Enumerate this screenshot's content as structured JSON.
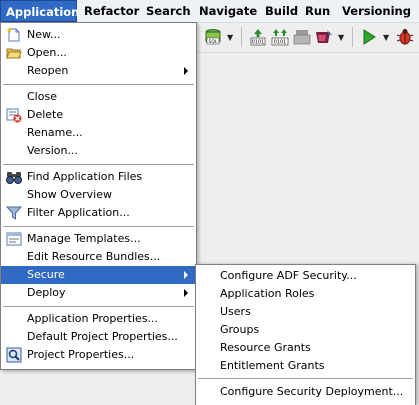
{
  "menubar": {
    "items": [
      "Application",
      "Refactor",
      "Search",
      "Navigate",
      "Build",
      "Run",
      "Versioning"
    ]
  },
  "toolbar": {
    "icons": [
      "sql-icon",
      "compile-icon",
      "make-icon",
      "rebuild-icon",
      "deploy-icon",
      "run-icon",
      "debug-icon"
    ]
  },
  "application_menu": {
    "new": "New...",
    "open": "Open...",
    "reopen": "Reopen",
    "close": "Close",
    "delete": "Delete",
    "rename": "Rename...",
    "version": "Version...",
    "find_files": "Find Application Files",
    "show_overview": "Show Overview",
    "filter": "Filter Application...",
    "manage_templates": "Manage Templates...",
    "edit_resource_bundles": "Edit Resource Bundles...",
    "secure": "Secure",
    "deploy": "Deploy",
    "app_properties": "Application Properties...",
    "default_project_properties": "Default Project Properties...",
    "project_properties": "Project Properties..."
  },
  "secure_menu": {
    "configure_adf": "Configure ADF Security...",
    "app_roles": "Application Roles",
    "users": "Users",
    "groups": "Groups",
    "resource_grants": "Resource Grants",
    "entitlement_grants": "Entitlement Grants",
    "configure_deployment": "Configure Security Deployment..."
  },
  "colors": {
    "selection": "#316ac5",
    "menubar_bg": "#eef1f6"
  }
}
